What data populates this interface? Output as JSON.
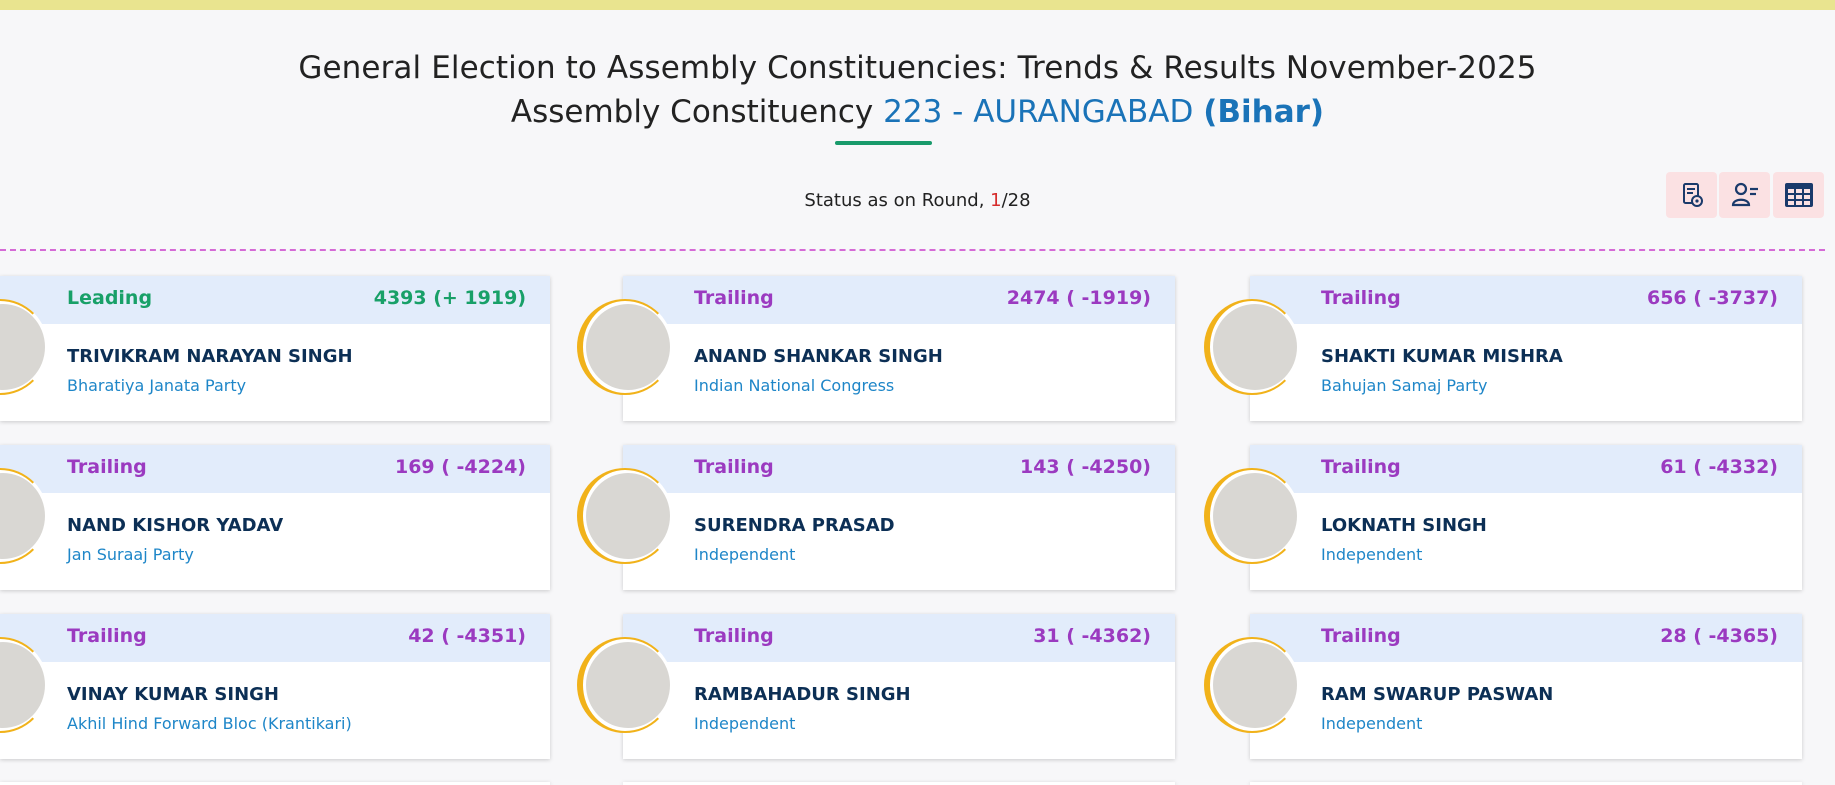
{
  "header": {
    "title": "General Election to Assembly Constituencies: Trends & Results November-2025",
    "ac_prefix": "Assembly Constituency",
    "ac_number_name": "223 - AURANGABAD",
    "ac_state": "(Bihar)"
  },
  "status": {
    "label": "Status as on Round, ",
    "current_round": "1",
    "total_rounds": "/28"
  },
  "toolbar": {
    "buttons": [
      {
        "icon": "document-settings-icon"
      },
      {
        "icon": "user-list-icon"
      },
      {
        "icon": "table-grid-icon"
      }
    ]
  },
  "candidates": [
    {
      "status": "Leading",
      "votes": "4393 (+ 1919)",
      "name": "TRIVIKRAM NARAYAN SINGH",
      "party": "Bharatiya Janata Party"
    },
    {
      "status": "Trailing",
      "votes": "2474 ( -1919)",
      "name": "ANAND SHANKAR SINGH",
      "party": "Indian National Congress"
    },
    {
      "status": "Trailing",
      "votes": "656 ( -3737)",
      "name": "SHAKTI KUMAR MISHRA",
      "party": "Bahujan Samaj Party"
    },
    {
      "status": "Trailing",
      "votes": "169 ( -4224)",
      "name": "NAND KISHOR YADAV",
      "party": "Jan Suraaj Party"
    },
    {
      "status": "Trailing",
      "votes": "143 ( -4250)",
      "name": "SURENDRA PRASAD",
      "party": "Independent"
    },
    {
      "status": "Trailing",
      "votes": "61 ( -4332)",
      "name": "LOKNATH SINGH",
      "party": "Independent"
    },
    {
      "status": "Trailing",
      "votes": "42 ( -4351)",
      "name": "VINAY KUMAR SINGH",
      "party": "Akhil Hind Forward Bloc (Krantikari)"
    },
    {
      "status": "Trailing",
      "votes": "31 ( -4362)",
      "name": "RAMBAHADUR SINGH",
      "party": "Independent"
    },
    {
      "status": "Trailing",
      "votes": "28 ( -4365)",
      "name": "RAM SWARUP PASWAN",
      "party": "Independent"
    }
  ],
  "colors": {
    "leading": "#18a068",
    "trailing": "#9b3ac0",
    "card_header": "#e2ecfb",
    "accent_blue": "#1a73b8",
    "avatar_ring": "#f1b21a"
  }
}
